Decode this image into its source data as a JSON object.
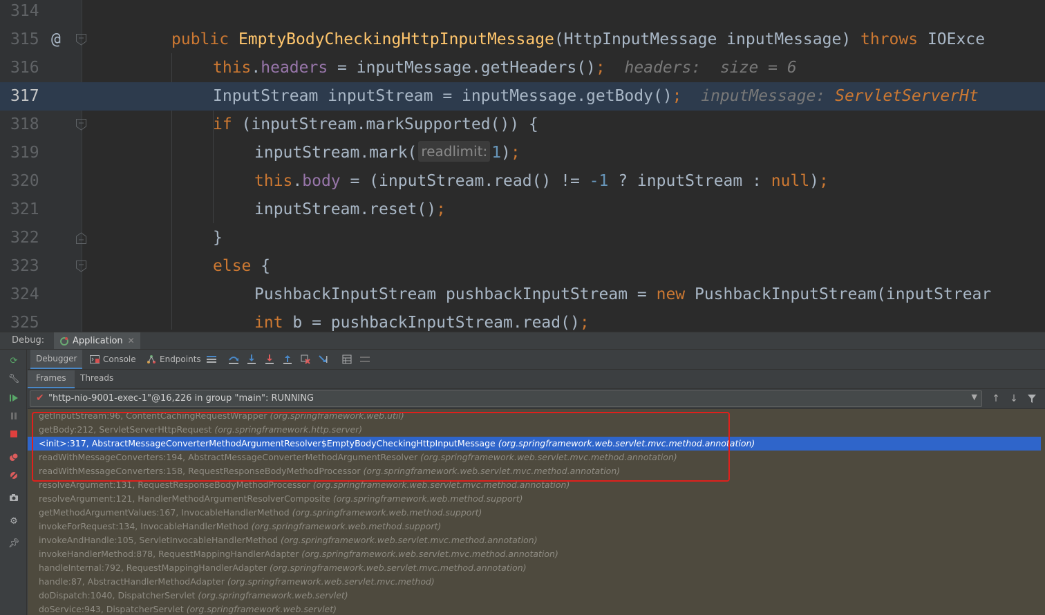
{
  "editor": {
    "lines": [
      {
        "num": "314"
      },
      {
        "num": "315",
        "gutter_mark": "@",
        "segments": [
          {
            "t": "public ",
            "c": "kw"
          },
          {
            "t": "EmptyBodyCheckingHttpInputMessage",
            "c": "fn"
          },
          {
            "t": "(HttpInputMessage inputMessage) ",
            "c": ""
          },
          {
            "t": "throws ",
            "c": "kw"
          },
          {
            "t": "IOExce",
            "c": ""
          }
        ]
      },
      {
        "num": "316",
        "segments": [
          {
            "t": "this",
            "c": "kw"
          },
          {
            "t": ".",
            "c": ""
          },
          {
            "t": "headers",
            "c": "fld"
          },
          {
            "t": " = inputMessage.getHeaders()",
            "c": ""
          },
          {
            "t": ";",
            "c": "kw"
          },
          {
            "t": "  headers:  size = 6",
            "c": "hint"
          }
        ]
      },
      {
        "num": "317",
        "current": true,
        "segments": [
          {
            "t": "InputStream inputStream = inputMessage.getBody()",
            "c": ""
          },
          {
            "t": ";",
            "c": "kw"
          },
          {
            "t": "  inputMessage: ",
            "c": "hint"
          },
          {
            "t": "ServletServerHt",
            "c": "hintval"
          }
        ]
      },
      {
        "num": "318",
        "segments": [
          {
            "t": "if ",
            "c": "kw"
          },
          {
            "t": "(inputStream.markSupported()) {",
            "c": ""
          }
        ]
      },
      {
        "num": "319",
        "segments": [
          {
            "t": "inputStream.mark(",
            "c": ""
          },
          {
            "t": "readlimit:",
            "c": "phint"
          },
          {
            "t": "1",
            "c": "num"
          },
          {
            "t": ")",
            "c": ""
          },
          {
            "t": ";",
            "c": "kw"
          }
        ]
      },
      {
        "num": "320",
        "segments": [
          {
            "t": "this",
            "c": "kw"
          },
          {
            "t": ".",
            "c": ""
          },
          {
            "t": "body",
            "c": "fld"
          },
          {
            "t": " = (inputStream.read() != ",
            "c": ""
          },
          {
            "t": "-1",
            "c": "num"
          },
          {
            "t": " ? inputStream : ",
            "c": ""
          },
          {
            "t": "null",
            "c": "kw"
          },
          {
            "t": ")",
            "c": ""
          },
          {
            "t": ";",
            "c": "kw"
          }
        ]
      },
      {
        "num": "321",
        "segments": [
          {
            "t": "inputStream.reset()",
            "c": ""
          },
          {
            "t": ";",
            "c": "kw"
          }
        ]
      },
      {
        "num": "322",
        "segments": [
          {
            "t": "}",
            "c": ""
          }
        ]
      },
      {
        "num": "323",
        "segments": [
          {
            "t": "else ",
            "c": "kw"
          },
          {
            "t": "{",
            "c": ""
          }
        ]
      },
      {
        "num": "324",
        "segments": [
          {
            "t": "PushbackInputStream pushbackInputStream = ",
            "c": ""
          },
          {
            "t": "new ",
            "c": "kw"
          },
          {
            "t": "PushbackInputStream(inputStrear",
            "c": ""
          }
        ]
      },
      {
        "num": "325",
        "segments": [
          {
            "t": "int ",
            "c": "kw"
          },
          {
            "t": "b = pushbackInputStream.read()",
            "c": ""
          },
          {
            "t": ";",
            "c": "kw"
          }
        ]
      }
    ]
  },
  "debug": {
    "label": "Debug:",
    "session_tab": "Application",
    "toolbar": {
      "debugger_tab": "Debugger",
      "console_tab": "Console",
      "endpoints_tab": "Endpoints"
    },
    "subtabs": {
      "frames": "Frames",
      "threads": "Threads"
    },
    "thread": "\"http-nio-9001-exec-1\"@16,226 in group \"main\": RUNNING",
    "frames": [
      {
        "method": "getInputStream:96, ContentCachingRequestWrapper",
        "pkg": "(org.springframework.web.util)"
      },
      {
        "method": "getBody:212, ServletServerHttpRequest",
        "pkg": "(org.springframework.http.server)"
      },
      {
        "method": "<init>:317, AbstractMessageConverterMethodArgumentResolver$EmptyBodyCheckingHttpInputMessage",
        "pkg": "(org.springframework.web.servlet.mvc.method.annotation)",
        "selected": true
      },
      {
        "method": "readWithMessageConverters:194, AbstractMessageConverterMethodArgumentResolver",
        "pkg": "(org.springframework.web.servlet.mvc.method.annotation)"
      },
      {
        "method": "readWithMessageConverters:158, RequestResponseBodyMethodProcessor",
        "pkg": "(org.springframework.web.servlet.mvc.method.annotation)"
      },
      {
        "method": "resolveArgument:131, RequestResponseBodyMethodProcessor",
        "pkg": "(org.springframework.web.servlet.mvc.method.annotation)"
      },
      {
        "method": "resolveArgument:121, HandlerMethodArgumentResolverComposite",
        "pkg": "(org.springframework.web.method.support)"
      },
      {
        "method": "getMethodArgumentValues:167, InvocableHandlerMethod",
        "pkg": "(org.springframework.web.method.support)"
      },
      {
        "method": "invokeForRequest:134, InvocableHandlerMethod",
        "pkg": "(org.springframework.web.method.support)"
      },
      {
        "method": "invokeAndHandle:105, ServletInvocableHandlerMethod",
        "pkg": "(org.springframework.web.servlet.mvc.method.annotation)"
      },
      {
        "method": "invokeHandlerMethod:878, RequestMappingHandlerAdapter",
        "pkg": "(org.springframework.web.servlet.mvc.method.annotation)"
      },
      {
        "method": "handleInternal:792, RequestMappingHandlerAdapter",
        "pkg": "(org.springframework.web.servlet.mvc.method.annotation)"
      },
      {
        "method": "handle:87, AbstractHandlerMethodAdapter",
        "pkg": "(org.springframework.web.servlet.mvc.method)"
      },
      {
        "method": "doDispatch:1040, DispatcherServlet",
        "pkg": "(org.springframework.web.servlet)"
      },
      {
        "method": "doService:943, DispatcherServlet",
        "pkg": "(org.springframework.web.servlet)"
      }
    ]
  },
  "colors": {
    "editor_bg": "#2b2b2b",
    "current_line": "#2d3b4d",
    "keyword": "#cc7832",
    "function": "#ffc66d",
    "field": "#9876aa",
    "number": "#6897bb",
    "selected_frame": "#2f65ca",
    "frames_bg": "#4e4a3e",
    "highlight_box": "#e0201c"
  }
}
